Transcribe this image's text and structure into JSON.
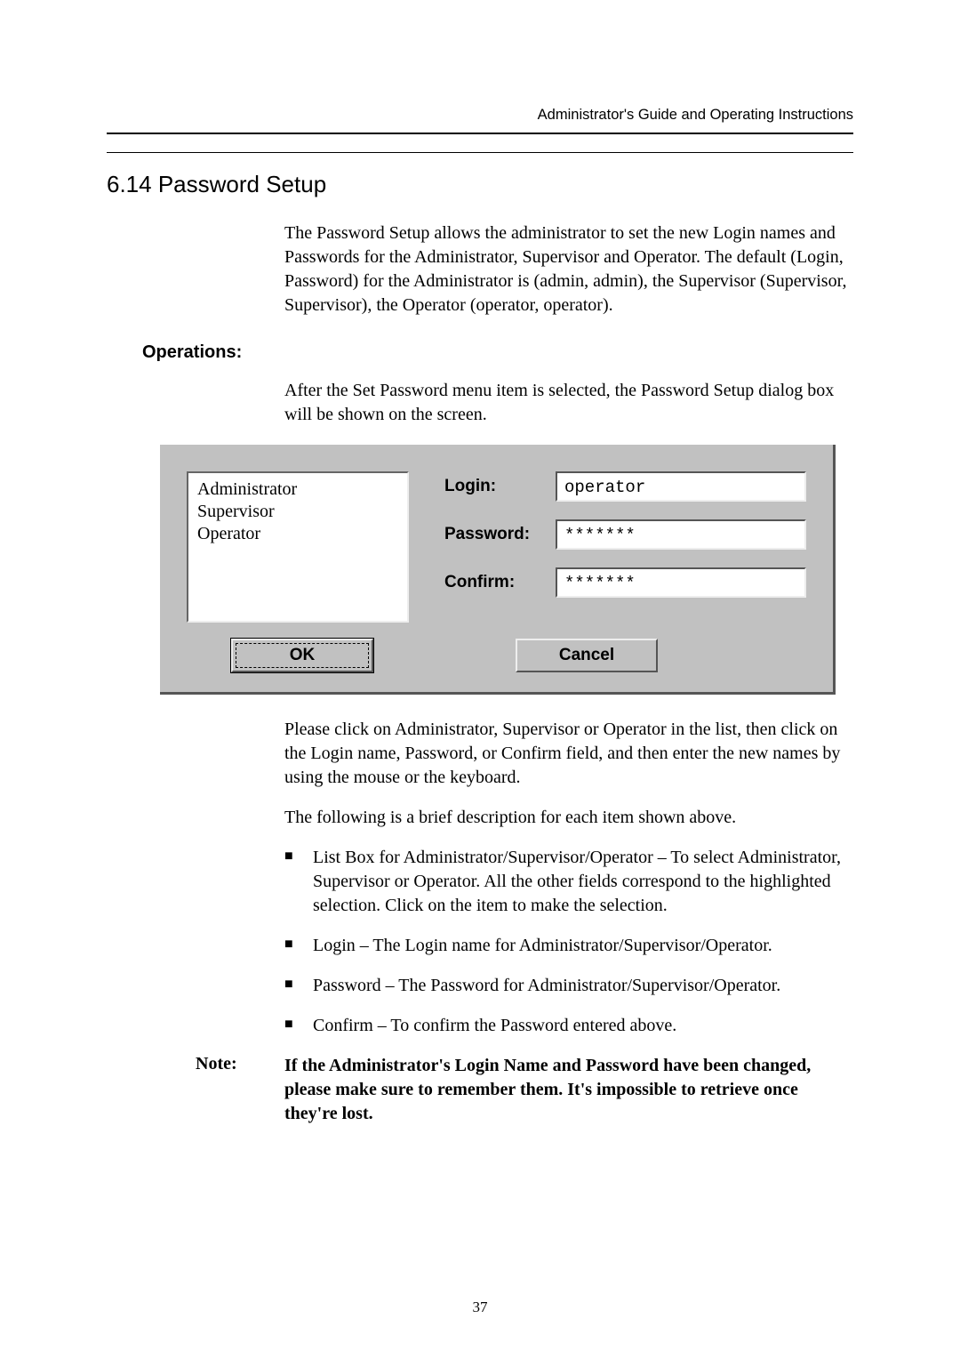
{
  "header": {
    "title": "Administrator's Guide and Operating Instructions"
  },
  "section": {
    "number_title": "6.14 Password Setup"
  },
  "intro": "The Password Setup allows the administrator to set the new Login names and Passwords for the Administrator, Supervisor and Operator. The default (Login, Password) for the Administrator is (admin, admin), the Supervisor (Supervisor, Supervisor), the Operator (operator, operator).",
  "operations": {
    "heading": "Operations:",
    "lead": "After the Set Password menu item is selected, the Password Setup dialog box will be shown on the screen."
  },
  "dialog": {
    "list_items": [
      "Administrator",
      "Supervisor",
      "Operator"
    ],
    "fields": {
      "login_label": "Login:",
      "login_value": "operator",
      "password_label": "Password:",
      "password_value": "*******",
      "confirm_label": "Confirm:",
      "confirm_value": "*******"
    },
    "ok_label": "OK",
    "cancel_label": "Cancel"
  },
  "after_dialog_1": "Please click on Administrator, Supervisor or Operator in the list, then click on the Login name, Password, or Confirm field, and then enter the new names by using the mouse or the keyboard.",
  "after_dialog_2": "The following is a brief description for each item shown above.",
  "bullets": [
    "List Box for Administrator/Supervisor/Operator – To select Administrator, Supervisor or Operator.    All the other fields correspond to the highlighted selection.    Click on the item to make the selection.",
    "Login – The Login name for Administrator/Supervisor/Operator.",
    "Password – The Password for Administrator/Supervisor/Operator.",
    "Confirm – To confirm the Password entered above."
  ],
  "note": {
    "label": "Note:",
    "body": "If the Administrator's Login Name and Password have been changed, please make sure to remember them.    It's impossible to retrieve once they're lost."
  },
  "page_number": "37"
}
